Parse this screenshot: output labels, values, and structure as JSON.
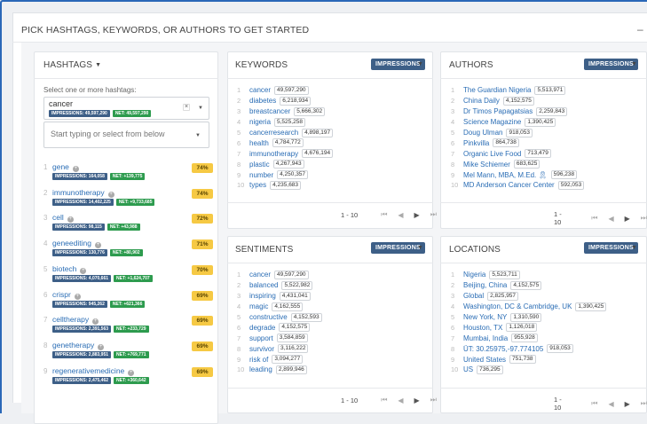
{
  "header": {
    "title": "PICK HASHTAGS, KEYWORDS, OR AUTHORS TO GET STARTED",
    "collapse_icon": "minus"
  },
  "hashtags": {
    "title": "HASHTAGS",
    "select_label": "Select one or more hashtags:",
    "selected": {
      "value": "cancer",
      "impressions": "IMPRESSIONS: 49,597,290",
      "net": "NET: 49,597,290"
    },
    "search_placeholder": "Start typing or select from below",
    "items": [
      {
        "n": "1",
        "name": "gene",
        "impressions": "IMPRESSIONS: 164,058",
        "net": "NET: +139,775",
        "pct": "74%"
      },
      {
        "n": "2",
        "name": "immunotherapy",
        "impressions": "IMPRESSIONS: 14,402,225",
        "net": "NET: +9,733,685",
        "pct": "74%"
      },
      {
        "n": "3",
        "name": "cell",
        "impressions": "IMPRESSIONS: 98,115",
        "net": "NET: +43,988",
        "pct": "72%"
      },
      {
        "n": "4",
        "name": "geneediting",
        "impressions": "IMPRESSIONS: 130,776",
        "net": "NET: +80,902",
        "pct": "71%"
      },
      {
        "n": "5",
        "name": "biotech",
        "impressions": "IMPRESSIONS: 4,070,661",
        "net": "NET: +1,624,707",
        "pct": "70%"
      },
      {
        "n": "6",
        "name": "crispr",
        "impressions": "IMPRESSIONS: 945,262",
        "net": "NET: +621,366",
        "pct": "69%"
      },
      {
        "n": "7",
        "name": "celltherapy",
        "impressions": "IMPRESSIONS: 2,391,563",
        "net": "NET: +233,729",
        "pct": "69%"
      },
      {
        "n": "8",
        "name": "genetherapy",
        "impressions": "IMPRESSIONS: 2,883,951",
        "net": "NET: +769,771",
        "pct": "69%"
      },
      {
        "n": "9",
        "name": "regenerativemedicine",
        "impressions": "IMPRESSIONS: 2,475,462",
        "net": "NET: +360,642",
        "pct": "69%"
      }
    ]
  },
  "keywords": {
    "title": "KEYWORDS",
    "sort": "IMPRESSIONS",
    "items": [
      {
        "n": "1",
        "term": "cancer",
        "count": "49,597,290"
      },
      {
        "n": "2",
        "term": "diabetes",
        "count": "6,218,934"
      },
      {
        "n": "3",
        "term": "breastcancer",
        "count": "5,666,302"
      },
      {
        "n": "4",
        "term": "nigeria",
        "count": "5,525,258"
      },
      {
        "n": "5",
        "term": "cancerresearch",
        "count": "4,898,197"
      },
      {
        "n": "6",
        "term": "health",
        "count": "4,784,772"
      },
      {
        "n": "7",
        "term": "immunotherapy",
        "count": "4,676,194"
      },
      {
        "n": "8",
        "term": "plastic",
        "count": "4,267,943"
      },
      {
        "n": "9",
        "term": "number",
        "count": "4,250,357"
      },
      {
        "n": "10",
        "term": "types",
        "count": "4,235,683"
      }
    ],
    "range": "1 - 10"
  },
  "authors": {
    "title": "AUTHORS",
    "sort": "IMPRESSIONS",
    "items": [
      {
        "n": "1",
        "term": "The Guardian Nigeria",
        "count": "5,513,971"
      },
      {
        "n": "2",
        "term": "China Daily",
        "count": "4,152,575"
      },
      {
        "n": "3",
        "term": "Dr Timos Papagatsias",
        "count": "2,259,843"
      },
      {
        "n": "4",
        "term": "Science Magazine",
        "count": "1,390,425"
      },
      {
        "n": "5",
        "term": "Doug Ulman",
        "count": "918,053"
      },
      {
        "n": "6",
        "term": "Pinkvilla",
        "count": "864,738"
      },
      {
        "n": "7",
        "term": "Organic Live Food",
        "count": "713,479"
      },
      {
        "n": "8",
        "term": "Mike Schiemer",
        "count": "683,625"
      },
      {
        "n": "9",
        "term": "Mel Mann, MBA, M.Ed. 🎗",
        "count": "596,238"
      },
      {
        "n": "10",
        "term": "MD Anderson Cancer Center",
        "count": "592,053"
      }
    ],
    "range": "1 - 10"
  },
  "sentiments": {
    "title": "SENTIMENTS",
    "sort": "IMPRESSIONS",
    "items": [
      {
        "n": "1",
        "term": "cancer",
        "count": "49,597,290"
      },
      {
        "n": "2",
        "term": "balanced",
        "count": "5,522,982"
      },
      {
        "n": "3",
        "term": "inspiring",
        "count": "4,431,041"
      },
      {
        "n": "4",
        "term": "magic",
        "count": "4,162,555"
      },
      {
        "n": "5",
        "term": "constructive",
        "count": "4,152,593"
      },
      {
        "n": "6",
        "term": "degrade",
        "count": "4,152,575"
      },
      {
        "n": "7",
        "term": "support",
        "count": "3,584,859"
      },
      {
        "n": "8",
        "term": "survivor",
        "count": "3,116,222"
      },
      {
        "n": "9",
        "term": "risk of",
        "count": "3,094,277"
      },
      {
        "n": "10",
        "term": "leading",
        "count": "2,899,946"
      }
    ],
    "range": "1 - 10"
  },
  "locations": {
    "title": "LOCATIONS",
    "sort": "IMPRESSIONS",
    "items": [
      {
        "n": "1",
        "term": "Nigeria",
        "count": "5,523,711"
      },
      {
        "n": "2",
        "term": "Beijing, China",
        "count": "4,152,575"
      },
      {
        "n": "3",
        "term": "Global",
        "count": "2,825,957"
      },
      {
        "n": "4",
        "term": "Washington, DC & Cambridge, UK",
        "count": "1,390,425"
      },
      {
        "n": "5",
        "term": "New York, NY",
        "count": "1,310,590"
      },
      {
        "n": "6",
        "term": "Houston, TX",
        "count": "1,126,018"
      },
      {
        "n": "7",
        "term": "Mumbai, India",
        "count": "955,928"
      },
      {
        "n": "8",
        "term": "ÜT: 30.25975,-97.774105",
        "count": "918,053"
      },
      {
        "n": "9",
        "term": "United States",
        "count": "751,738"
      },
      {
        "n": "10",
        "term": "US",
        "count": "736,295"
      }
    ],
    "range": "1 - 10"
  },
  "colors": {
    "accent": "#3d5f87",
    "net": "#2d9b4e",
    "pct": "#f6c944",
    "link": "#2a6db5"
  }
}
